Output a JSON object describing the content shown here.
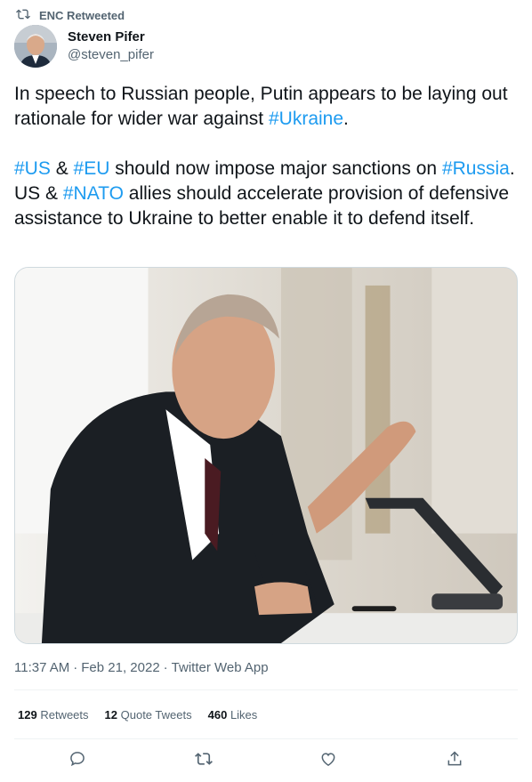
{
  "retweet_banner": {
    "label": "ENC Retweeted",
    "icon": "retweet-icon"
  },
  "author": {
    "display_name": "Steven Pifer",
    "handle": "@steven_pifer"
  },
  "tweet": {
    "p1_before": "In speech to Russian people, Putin appears to be laying out rationale for wider war against ",
    "p1_tag": "#Ukraine",
    "p1_after": ".",
    "p2_tag_us": "#US",
    "p2_amp1": " & ",
    "p2_tag_eu": "#EU",
    "p2_text1": " should now impose major sanctions on ",
    "p2_tag_russia": "#Russia",
    "p2_text2": ". US & ",
    "p2_tag_nato": "#NATO",
    "p2_text3": " allies should accelerate provision of defensive assistance to Ukraine to better enable it to defend itself."
  },
  "meta": {
    "time": "11:37 AM",
    "sep1": "·",
    "date": "Feb 21, 2022",
    "sep2": "·",
    "source": "Twitter Web App"
  },
  "stats": {
    "retweets_count": "129",
    "retweets_label": "Retweets",
    "quotes_count": "12",
    "quotes_label": "Quote Tweets",
    "likes_count": "460",
    "likes_label": "Likes"
  },
  "actions": [
    "reply-icon",
    "retweet-icon",
    "like-icon",
    "share-icon"
  ],
  "colors": {
    "accent": "#1d9bf0",
    "secondary": "#536471",
    "text": "#0f1419"
  }
}
